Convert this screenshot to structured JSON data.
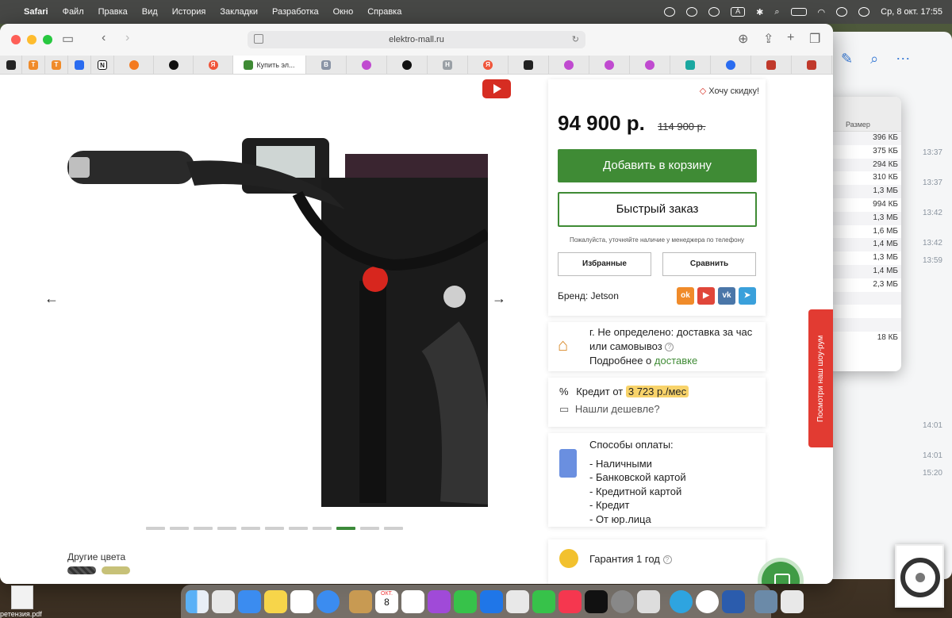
{
  "menubar": {
    "app": "Safari",
    "items": [
      "Файл",
      "Правка",
      "Вид",
      "История",
      "Закладки",
      "Разработка",
      "Окно",
      "Справка"
    ],
    "clock": "Ср, 8 окт.  17:55",
    "input_source": "A"
  },
  "browser": {
    "url": "elektro-mall.ru",
    "active_tab": "Купить эл...",
    "tab_favicons": [
      "dark",
      "T",
      "T",
      "blue",
      "N",
      "orange",
      "plus",
      "Я",
      "active",
      "B",
      "grid",
      "plus",
      "H",
      "Я",
      "dark",
      "grid",
      "grid",
      "grid",
      "fish",
      "blue",
      "figure",
      "figure"
    ]
  },
  "product": {
    "discount_link": "Хочу скидку!",
    "price": "94 900 р.",
    "old_price": "114 900 р.",
    "add_to_cart": "Добавить в корзину",
    "quick_order": "Быстрый заказ",
    "availability_hint": "Пожалуйста, уточняйте наличие у менеджера по телефону",
    "favorites": "Избранные",
    "compare": "Сравнить",
    "brand": "Бренд: Jetson",
    "social": [
      "ok",
      "youtube",
      "vk",
      "telegram"
    ],
    "other_colors": "Другие цвета",
    "gallery_dots": 11,
    "gallery_active": 9
  },
  "delivery": {
    "line1": "г. Не определено: доставка за час",
    "line2": "или самовывоз",
    "more_prefix": "Подробнее о ",
    "more_link": "доставке"
  },
  "credit": {
    "prefix": "Кредит от ",
    "amount": "3 723 р./мес",
    "cheaper": "Нашли дешевле?"
  },
  "payment": {
    "title": "Способы оплаты:",
    "methods": [
      "- Наличными",
      "- Банковской картой",
      "- Кредитной картой",
      "- Кредит",
      "- От юр.лица"
    ]
  },
  "warranty": {
    "text": "Гарантия 1 год"
  },
  "showroom_tab": "Посмотри наш шоу-рум",
  "finder": {
    "column": "Размер",
    "sizes": [
      "396 КБ",
      "375 КБ",
      "294 КБ",
      "310 КБ",
      "1,3 МБ",
      "994 КБ",
      "1,3 МБ",
      "1,6 МБ",
      "1,4 МБ",
      "1,3 МБ",
      "1,4 МБ",
      "2,3 МБ",
      "",
      "",
      "",
      "18 КБ"
    ]
  },
  "messenger": {
    "times": [
      "13:37",
      "13:37",
      "13:42",
      "13:42",
      "13:59",
      "14:01",
      "14:01",
      "15:20"
    ]
  },
  "desktop_file": "ретензия.pdf",
  "dock": {
    "calendar_month": "ОКТ.",
    "calendar_day": "8"
  },
  "colors": {
    "accent_green": "#3f8b35",
    "price_badge": "#f8d36a",
    "showroom_red": "#e23b32"
  }
}
